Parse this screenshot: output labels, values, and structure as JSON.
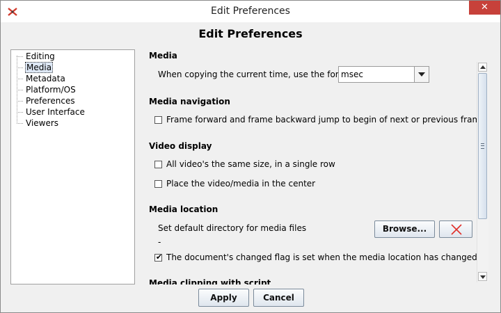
{
  "window": {
    "title": "Edit Preferences",
    "close_glyph": "✕",
    "icon": "elan-app-icon"
  },
  "heading": "Edit Preferences",
  "tree": {
    "items": [
      {
        "label": "Editing",
        "selected": false
      },
      {
        "label": "Media",
        "selected": true
      },
      {
        "label": "Metadata",
        "selected": false
      },
      {
        "label": "Platform/OS",
        "selected": false
      },
      {
        "label": "Preferences",
        "selected": false
      },
      {
        "label": "User Interface",
        "selected": false
      },
      {
        "label": "Viewers",
        "selected": false
      }
    ]
  },
  "panel": {
    "media": {
      "title": "Media",
      "format_label": "When copying the current time, use the format",
      "format_value": "msec"
    },
    "media_navigation": {
      "title": "Media navigation",
      "frame_jump_label": "Frame forward and frame backward jump to begin of next or previous frame",
      "frame_jump_checked": false
    },
    "video_display": {
      "title": "Video display",
      "same_size_label": "All video's the same size, in a single row",
      "same_size_checked": false,
      "center_label": "Place the video/media in the center",
      "center_checked": false
    },
    "media_location": {
      "title": "Media location",
      "default_dir_label": "Set default directory for media files",
      "default_dir_value": "-",
      "browse_label": "Browse...",
      "changed_flag_label": "The document's changed flag is set when the media location has changed",
      "changed_flag_checked": true,
      "check_glyph": "✔"
    },
    "next_section_title": "Media clipping with script"
  },
  "footer": {
    "apply_label": "Apply",
    "cancel_label": "Cancel"
  },
  "colors": {
    "close_button": "#c7413a",
    "selection": "#dde7f5",
    "clear_icon": "#e0302a"
  }
}
